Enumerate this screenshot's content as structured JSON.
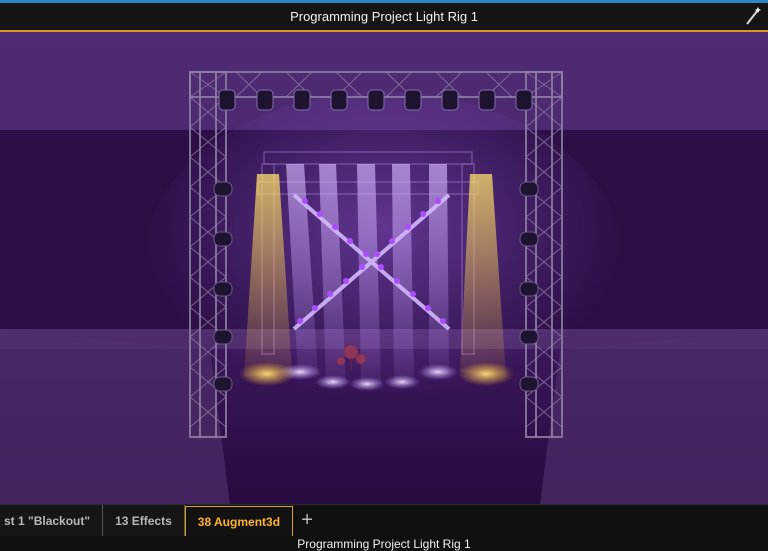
{
  "window": {
    "title": "Programming Project Light Rig 1"
  },
  "tabs": [
    {
      "label": "st 1 \"Blackout\"",
      "active": false
    },
    {
      "label": "13 Effects",
      "active": false
    },
    {
      "label": "38 Augment3d",
      "active": true
    }
  ],
  "add_tab_label": "+",
  "status": {
    "text": "Programming Project Light Rig 1"
  },
  "icons": {
    "wand": "magic-wand-icon",
    "add": "plus-icon"
  },
  "colors": {
    "accent": "#d39b1b",
    "top_line": "#2a86c6",
    "stage_purple": "#3b175f",
    "beam_violet": "#b680ff",
    "beam_amber": "#ffd04d"
  }
}
